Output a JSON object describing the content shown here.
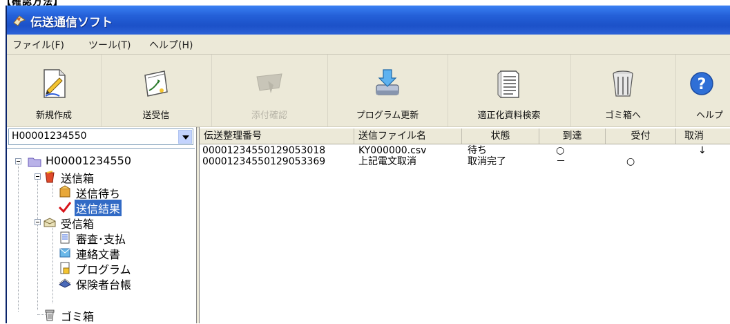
{
  "caption": "【確認方法】",
  "window": {
    "title": "伝送通信ソフト"
  },
  "menu": [
    "ファイル(F)",
    "ツール(T)",
    "ヘルプ(H)"
  ],
  "toolbar": [
    {
      "label": "新規作成",
      "icon": "new-document-icon",
      "enabled": true
    },
    {
      "label": "送受信",
      "icon": "send-receive-icon",
      "enabled": true
    },
    {
      "label": "添付確認",
      "icon": "attachment-check-icon",
      "enabled": false
    },
    {
      "label": "プログラム更新",
      "icon": "program-update-icon",
      "enabled": true
    },
    {
      "label": "適正化資料検索",
      "icon": "document-search-icon",
      "enabled": true
    },
    {
      "label": "ゴミ箱へ",
      "icon": "trash-icon",
      "enabled": true
    },
    {
      "label": "ヘルプ",
      "icon": "help-icon",
      "enabled": true
    }
  ],
  "combo": {
    "value": "H00001234550"
  },
  "tree": {
    "root": "H00001234550",
    "outbox": "送信箱",
    "outbox_pending": "送信待ち",
    "outbox_results": "送信結果",
    "inbox": "受信箱",
    "inbox_review": "審査･支払",
    "inbox_notices": "連絡文書",
    "inbox_programs": "プログラム",
    "inbox_insurers": "保険者台帳",
    "trash": "ゴミ箱"
  },
  "table": {
    "columns": [
      "伝送整理番号",
      "送信ファイル名",
      "状態",
      "到達",
      "受付",
      "取消"
    ],
    "rows": [
      [
        "00001234550129053018",
        "KY000000.csv",
        "待ち",
        "○",
        "",
        "↓"
      ],
      [
        "00001234550129053369",
        "上記電文取消",
        "取消完了",
        "－",
        "○",
        ""
      ]
    ]
  },
  "colors": {
    "titlebar": "#2460d8",
    "selection": "#316ac5",
    "chrome": "#ece9d8"
  }
}
